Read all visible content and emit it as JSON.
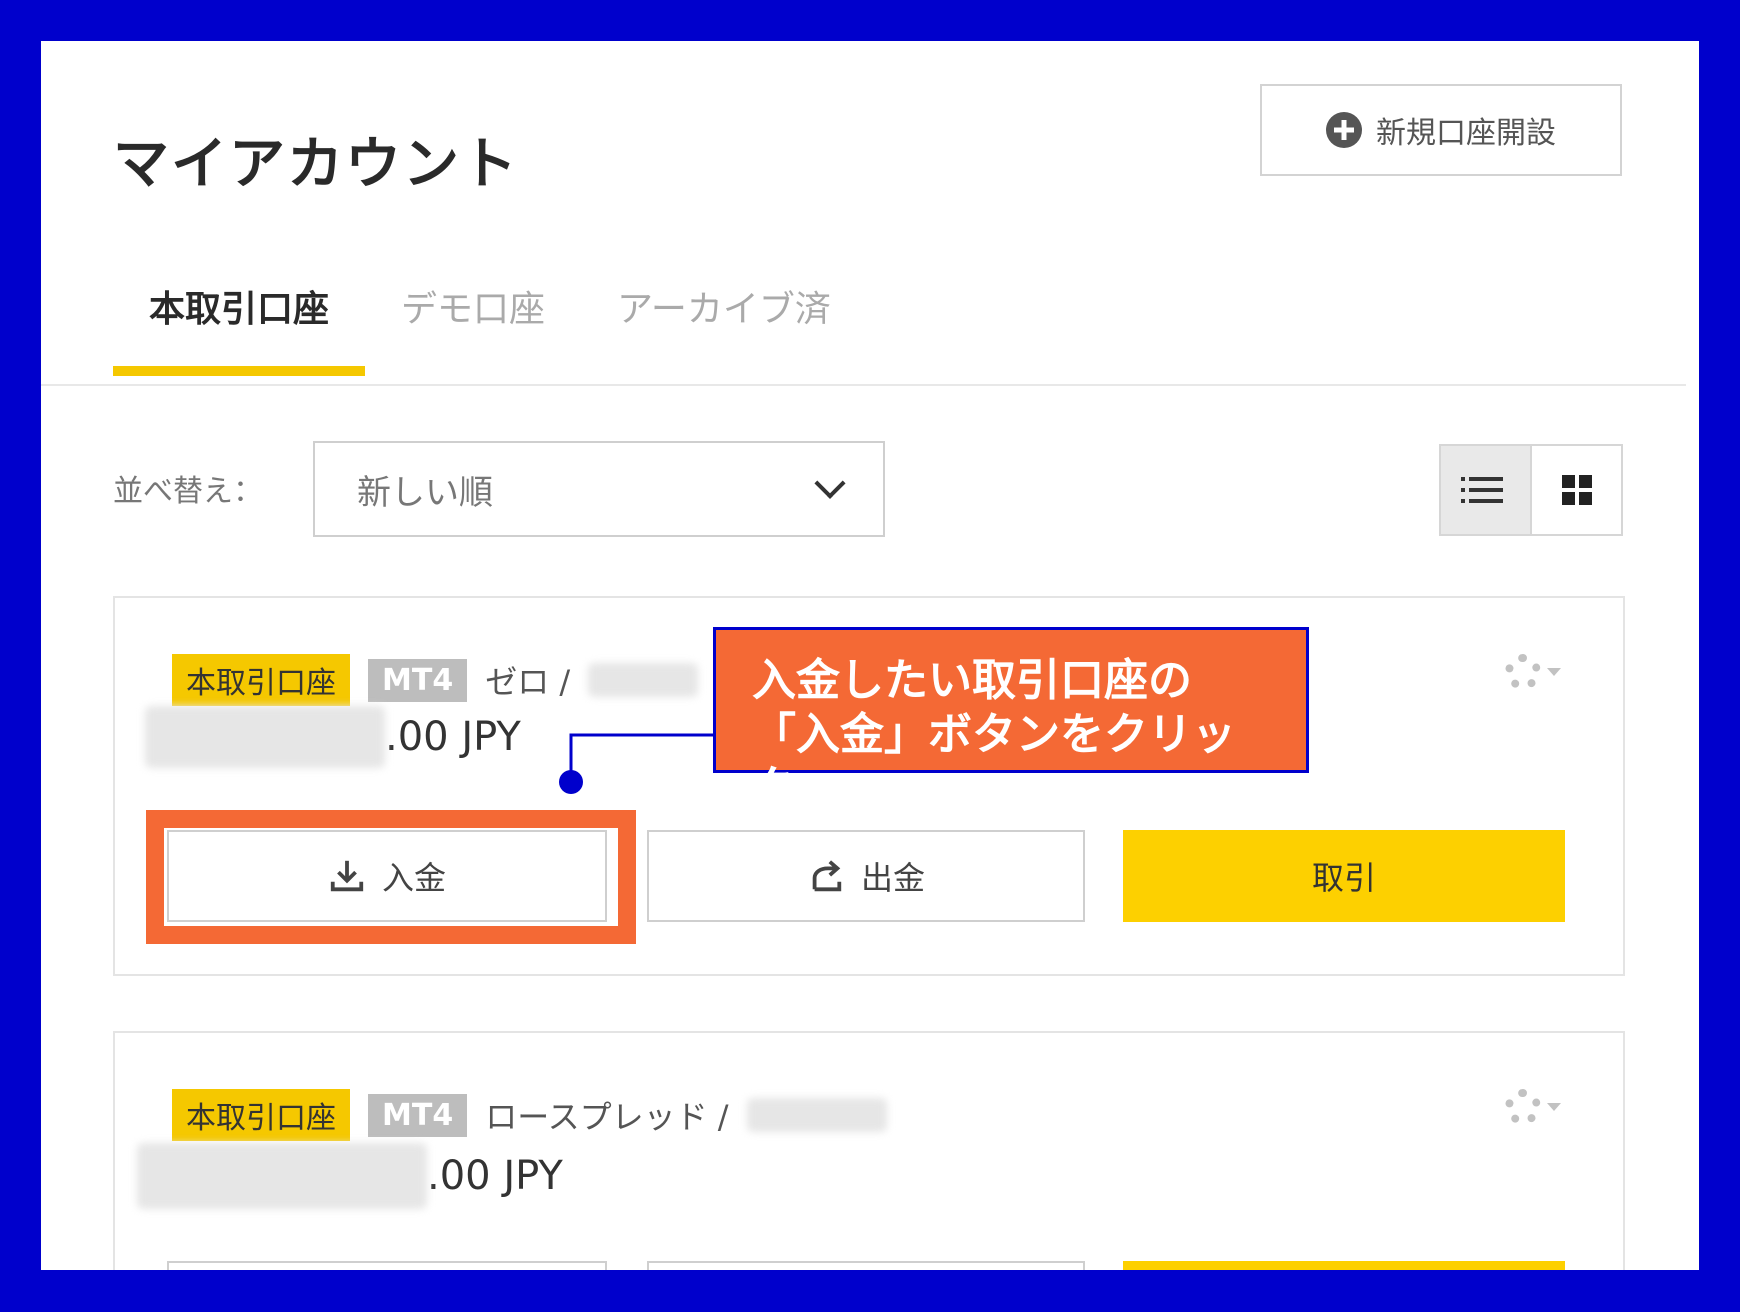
{
  "page": {
    "title": "マイアカウント",
    "new_account_label": "新規口座開設"
  },
  "tabs": [
    {
      "label": "本取引口座",
      "active": true
    },
    {
      "label": "デモ口座",
      "active": false
    },
    {
      "label": "アーカイブ済",
      "active": false
    }
  ],
  "sort": {
    "label": "並べ替え：",
    "selected": "新しい順"
  },
  "view_toggle": {
    "selected": "list"
  },
  "accounts": [
    {
      "badge": "本取引口座",
      "platform": "MT4",
      "type": "ゼロ /",
      "balance_suffix": ".00 JPY",
      "deposit_label": "入金",
      "withdraw_label": "出金",
      "trade_label": "取引"
    },
    {
      "badge": "本取引口座",
      "platform": "MT4",
      "type": "ロースプレッド /",
      "balance_suffix": ".00 JPY"
    }
  ],
  "callout": {
    "line1": "入金したい取引口座の",
    "line2": "「入金」ボタンをクリック"
  },
  "colors": {
    "frame": "#0000cc",
    "accent": "#f5c800",
    "highlight": "#f46935",
    "trade_button": "#fdd000"
  }
}
